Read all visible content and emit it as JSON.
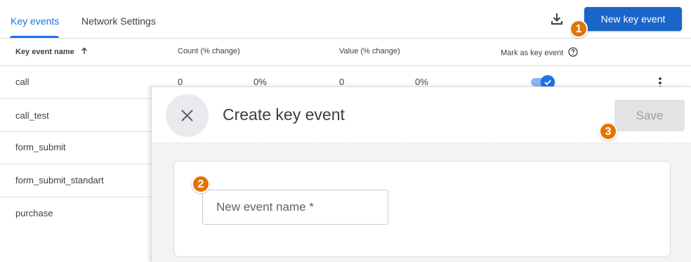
{
  "tabs": [
    {
      "label": "Key events",
      "active": true
    },
    {
      "label": "Network Settings",
      "active": false
    }
  ],
  "toolbar": {
    "download_icon": "download-icon",
    "new_key_event_label": "New key event"
  },
  "table": {
    "headers": {
      "name": "Key event name",
      "count": "Count (% change)",
      "value": "Value (% change)",
      "mark": "Mark as key event"
    },
    "rows": [
      {
        "name": "call",
        "count": "0",
        "count_change": "0%",
        "value": "0",
        "value_change": "0%",
        "marked": true
      },
      {
        "name": "call_test"
      },
      {
        "name": "form_submit"
      },
      {
        "name": "form_submit_standart"
      },
      {
        "name": "purchase"
      }
    ]
  },
  "panel": {
    "title": "Create key event",
    "save_label": "Save",
    "input_placeholder": "New event name *"
  },
  "annotations": [
    "1",
    "2",
    "3"
  ],
  "colors": {
    "accent": "#1a73e8",
    "primary_button": "#1a65c8",
    "badge": "#e37400"
  }
}
